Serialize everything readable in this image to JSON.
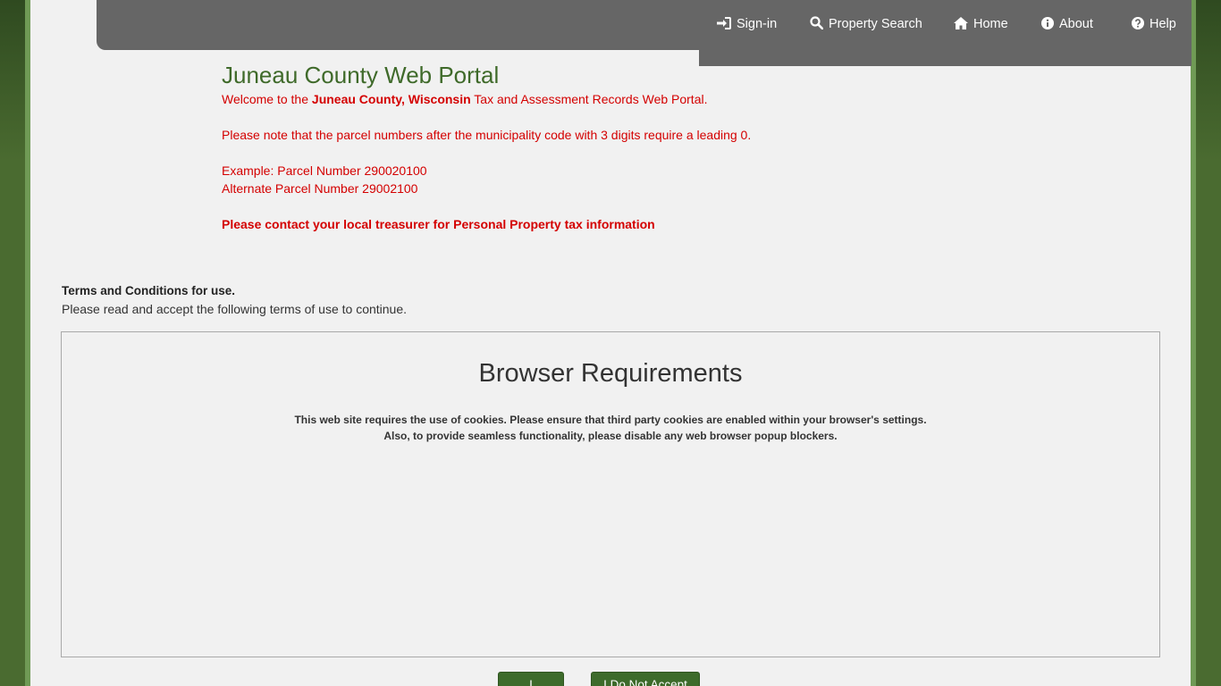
{
  "nav": {
    "items": [
      {
        "label": "Sign-in",
        "icon": "sign-in-icon"
      },
      {
        "label": "Property Search",
        "icon": "search-icon"
      },
      {
        "label": "Home",
        "icon": "home-icon"
      },
      {
        "label": "About",
        "icon": "info-icon"
      },
      {
        "label": "Help",
        "icon": "help-icon"
      }
    ]
  },
  "intro": {
    "title": "Juneau County Web Portal",
    "welcome_prefix": "Welcome to the ",
    "welcome_bold": "Juneau County, Wisconsin",
    "welcome_suffix": " Tax and Assessment Records Web Portal.",
    "parcel_note": "Please note that the parcel numbers after the municipality code with 3 digits require a leading 0.",
    "example_1": "Example: Parcel Number 290020100",
    "example_2": "Alternate Parcel Number 29002100",
    "contact": "Please contact your local treasurer for Personal Property tax information"
  },
  "terms": {
    "heading": "Terms and Conditions for use.",
    "instructions": "Please read and accept the following terms of use to continue.",
    "box_title": "Browser Requirements",
    "line_1": "This web site requires the use of cookies. Please ensure that third party cookies are enabled within your browser's settings.",
    "line_2": "Also, to provide seamless functionality, please disable any web browser popup blockers."
  },
  "buttons": {
    "accept": "I Accept",
    "decline": "I Do Not Accept"
  },
  "colors": {
    "accent_green": "#3f6a2a",
    "alert_red": "#d40000",
    "nav_gray": "#666666"
  }
}
